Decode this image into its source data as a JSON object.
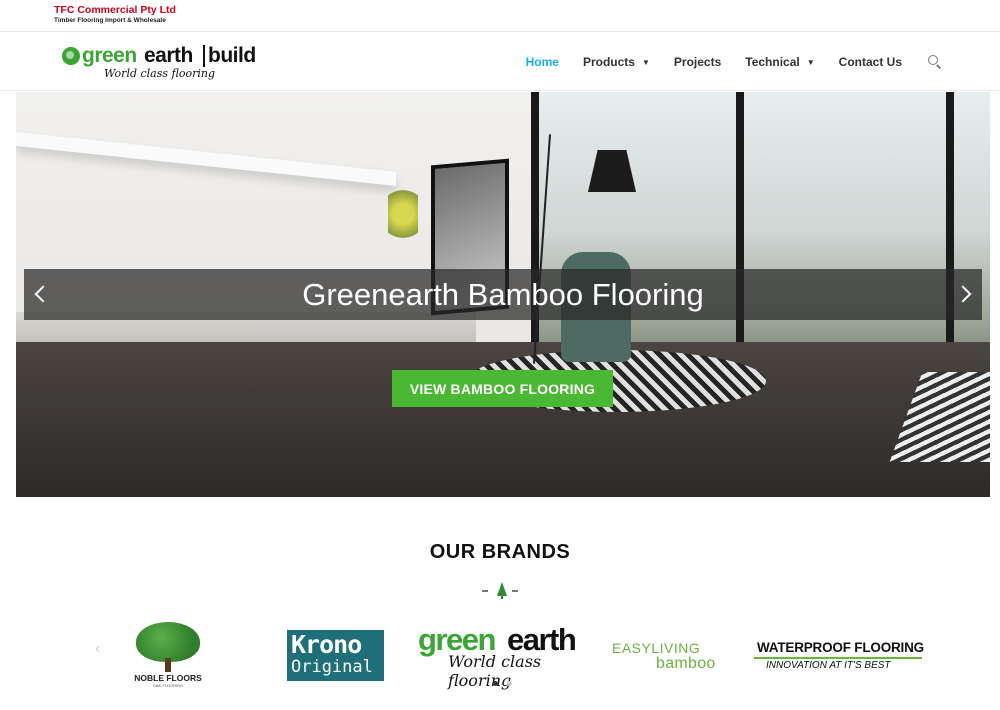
{
  "topbar": {
    "company": "TFC Commercial Pty Ltd",
    "tagline": "Timber Flooring Import & Wholesale"
  },
  "header": {
    "logo": {
      "green": "green",
      "earth": "earth",
      "build": "build",
      "slogan": "World class flooring"
    },
    "nav": [
      {
        "label": "Home",
        "active": true
      },
      {
        "label": "Products",
        "dropdown": true
      },
      {
        "label": "Projects"
      },
      {
        "label": "Technical",
        "dropdown": true
      },
      {
        "label": "Contact Us"
      }
    ],
    "search_icon": "search-icon"
  },
  "hero": {
    "caption": "Greenearth Bamboo Flooring",
    "cta": "VIEW BAMBOO FLOORING",
    "prev_icon": "chevron-left-icon",
    "next_icon": "chevron-right-icon",
    "cta_color": "#4bb833"
  },
  "brands": {
    "title": "OUR BRANDS",
    "divider_icon": "tree-icon",
    "logos": {
      "noble": {
        "name": "NOBLE FLOORS",
        "sub": "OAK FLOORING"
      },
      "krono": {
        "line1": "Krono",
        "line2": "Original"
      },
      "greenearth": {
        "green": "green",
        "earth": "earth",
        "slogan": "World class flooring"
      },
      "easyliving": {
        "line1": "EASYLIVING",
        "line2": "bamboo"
      },
      "waterproof": {
        "line1": "WATERPROOF FLOORING",
        "line2": "INNOVATION AT IT'S BEST"
      }
    },
    "pages": 2,
    "current_page": 1
  },
  "colors": {
    "accent": "#13aff0",
    "brand_green": "#3aa635",
    "company_red": "#d0021b"
  }
}
